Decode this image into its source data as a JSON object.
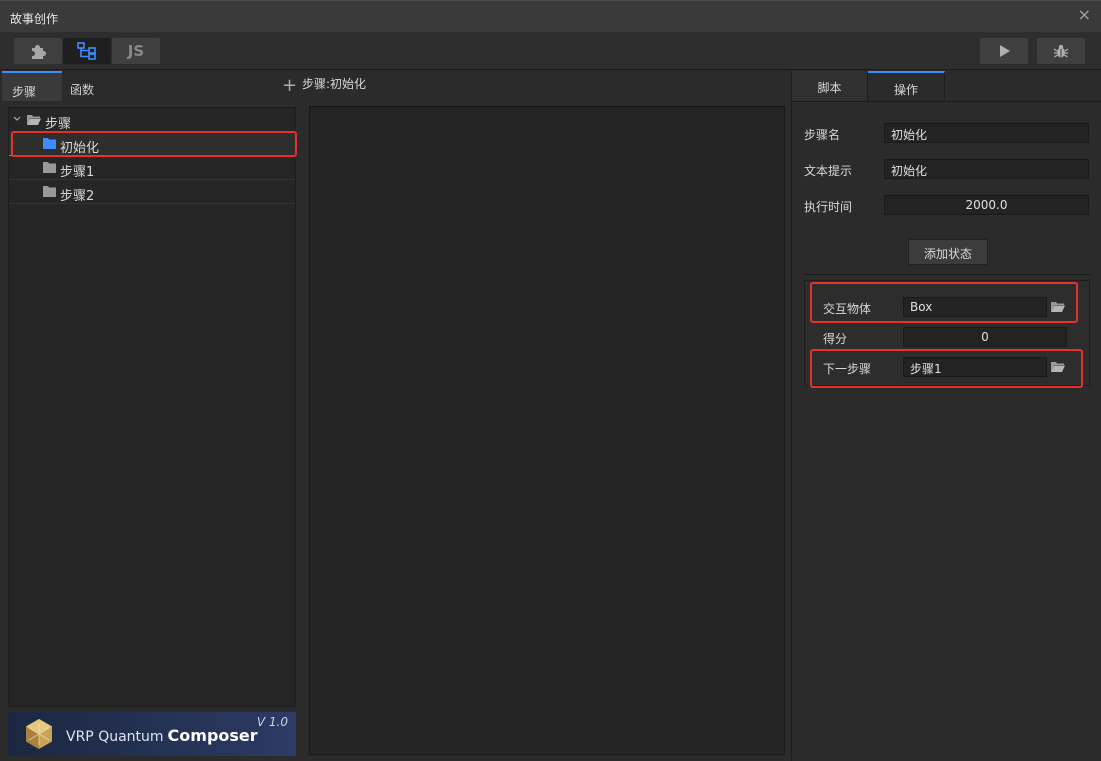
{
  "window": {
    "title": "故事创作",
    "close_glyph": "×"
  },
  "toolbar": {
    "buttons": [
      {
        "name": "puzzle-icon"
      },
      {
        "name": "flowchart-icon"
      },
      {
        "label": "JS"
      }
    ],
    "play_icon": "play-icon",
    "debug_icon": "bug-icon"
  },
  "left_panel": {
    "tabs": [
      {
        "label": "步骤"
      },
      {
        "label": "函数"
      }
    ],
    "tree": {
      "root": {
        "label": "步骤"
      },
      "items": [
        {
          "label": "初始化",
          "selected": true
        },
        {
          "label": "步骤1"
        },
        {
          "label": "步骤2"
        }
      ]
    },
    "logo": {
      "text": "VRP Quantum",
      "bold": "Composer",
      "version": "V 1.0"
    }
  },
  "middle": {
    "add_glyph": "+",
    "title": "步骤:初始化"
  },
  "right_panel": {
    "tabs": [
      {
        "label": "脚本"
      },
      {
        "label": "操作"
      }
    ],
    "fields": {
      "step_name": {
        "label": "步骤名",
        "value": "初始化"
      },
      "text_hint": {
        "label": "文本提示",
        "value": "初始化"
      },
      "exec_time": {
        "label": "执行时间",
        "value": "2000.0"
      }
    },
    "add_state_label": "添加状态",
    "state": {
      "interact_object": {
        "label": "交互物体",
        "value": "Box"
      },
      "score": {
        "label": "得分",
        "value": "0"
      },
      "next_step": {
        "label": "下一步骤",
        "value": "步骤1"
      }
    }
  },
  "colors": {
    "accent": "#3f8cff",
    "highlight": "#e5332a",
    "background": "#2b2b2b"
  }
}
